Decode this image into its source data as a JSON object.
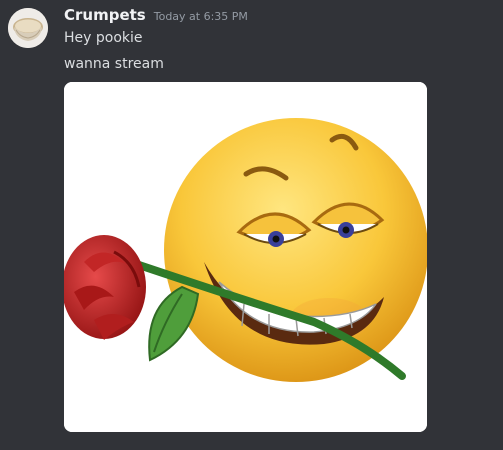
{
  "message": {
    "author": "Crumpets",
    "timestamp": "Today at 6:35 PM",
    "lines": [
      "Hey pookie",
      "wanna stream"
    ],
    "avatar_icon": "bread-bowl-avatar-icon",
    "attachment_icon": "smirking-emoji-with-rose-icon"
  },
  "colors": {
    "background": "#313338",
    "username": "#f2f3f5",
    "text": "#dbdee1",
    "timestamp": "#949ba4"
  }
}
